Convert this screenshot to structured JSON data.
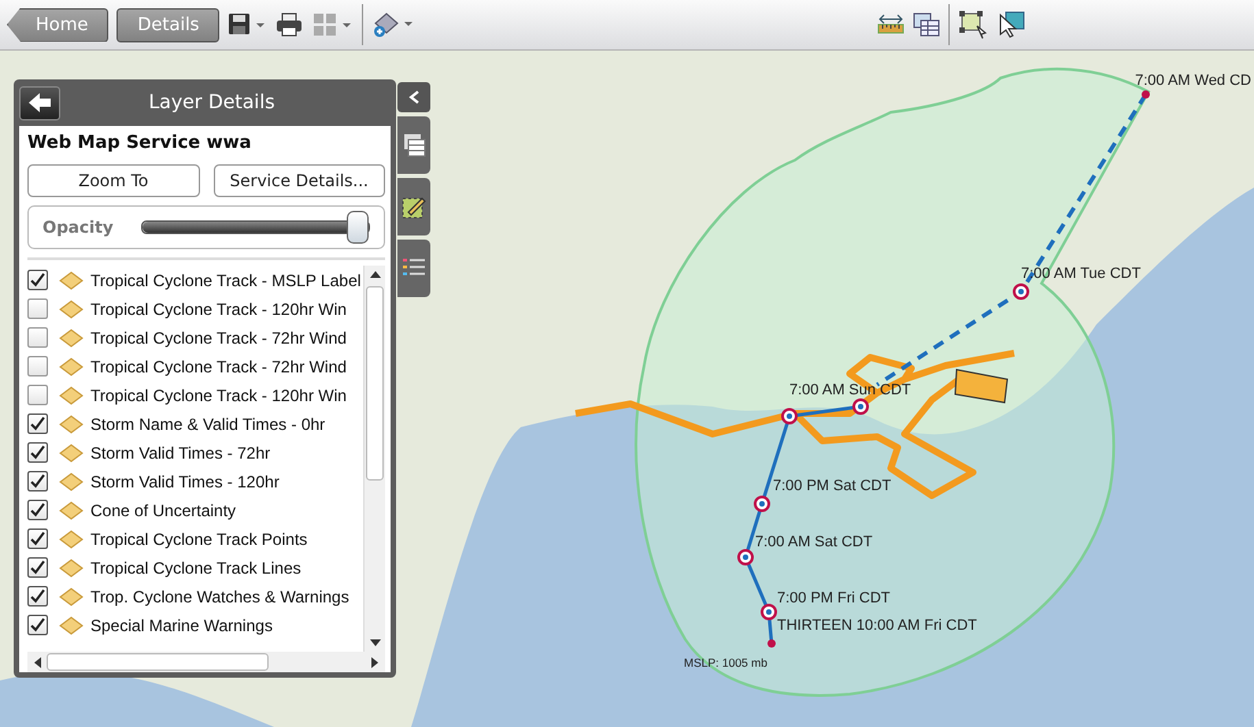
{
  "toolbar": {
    "nav_buttons": [
      {
        "label": "Home",
        "kind": "back"
      },
      {
        "label": "Details",
        "kind": "plain"
      }
    ]
  },
  "panel": {
    "title": "Layer Details",
    "service_title": "Web Map Service wwa",
    "buttons": [
      "Zoom To",
      "Service Details..."
    ],
    "opacity": {
      "label": "Opacity",
      "level": 1
    },
    "layers": [
      {
        "label": "Tropical Cyclone Track - MSLP Label",
        "checked": true
      },
      {
        "label": "Tropical Cyclone Track - 120hr Win",
        "checked": false
      },
      {
        "label": "Tropical Cyclone Track - 72hr Wind",
        "checked": false
      },
      {
        "label": "Tropical Cyclone Track - 72hr Wind",
        "checked": false
      },
      {
        "label": "Tropical Cyclone Track - 120hr Win",
        "checked": false
      },
      {
        "label": "Storm Name & Valid Times - 0hr",
        "checked": true
      },
      {
        "label": "Storm Valid Times - 72hr",
        "checked": true
      },
      {
        "label": "Storm Valid Times - 120hr",
        "checked": true
      },
      {
        "label": "Cone of Uncertainty",
        "checked": true
      },
      {
        "label": "Tropical Cyclone Track Points",
        "checked": true
      },
      {
        "label": "Tropical Cyclone Track Lines",
        "checked": true
      },
      {
        "label": "Trop. Cyclone Watches & Warnings",
        "checked": true
      },
      {
        "label": "Special Marine Warnings",
        "checked": true
      }
    ]
  },
  "map": {
    "track_labels": [
      "7:00 AM Wed CD",
      "7:00 AM Tue CDT",
      "7:00 AM Sun CDT",
      "7:00 PM Sat CDT",
      "7:00 AM Sat CDT",
      "7:00 PM Fri CDT",
      "THIRTEEN 10:00 AM Fri CDT"
    ],
    "pressure_label": "MSLP: 1005 mb"
  }
}
